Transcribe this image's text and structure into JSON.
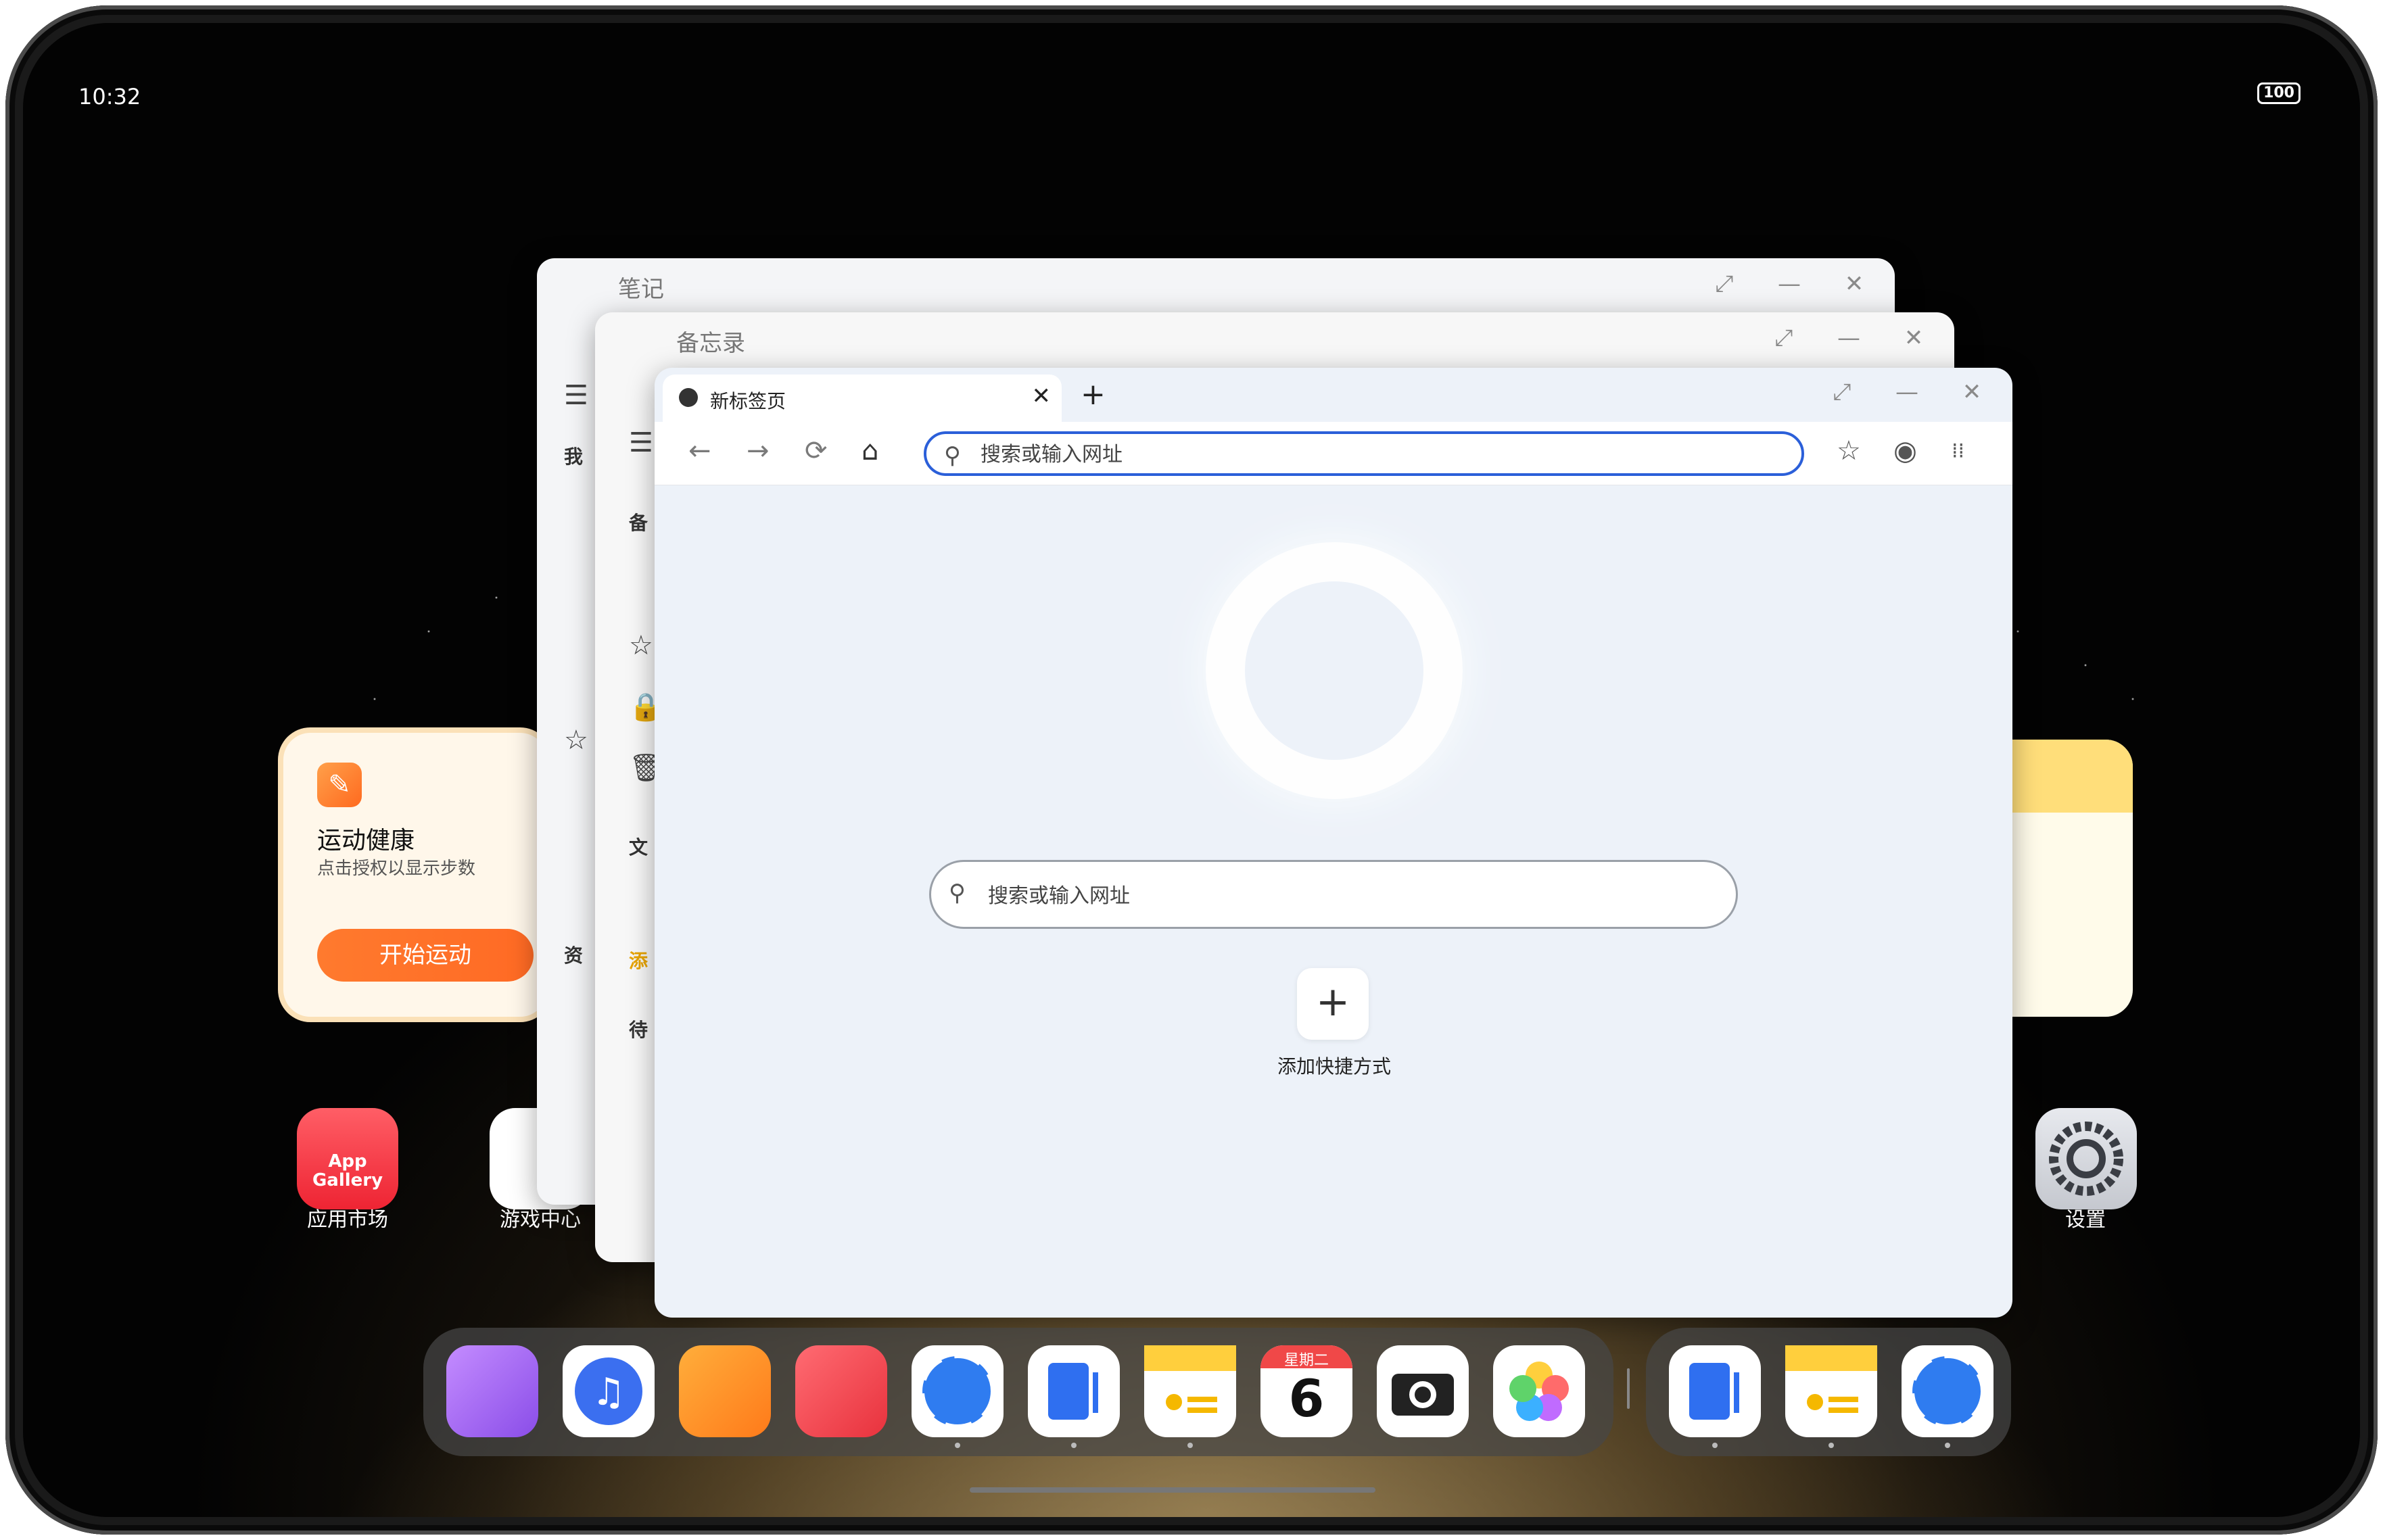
{
  "status": {
    "time": "10:32",
    "battery": "100"
  },
  "widgets": {
    "health": {
      "title": "运动健康",
      "subtitle": "点击授权以显示步数",
      "button": "开始运动"
    }
  },
  "desktop_apps": [
    {
      "label": "应用市场",
      "icon_text": "App Gallery"
    },
    {
      "label": "游戏中心"
    },
    {
      "label": "设置"
    }
  ],
  "windows": {
    "notes": {
      "title": "笔记",
      "sidebar_items": [
        "我",
        "资"
      ]
    },
    "memo": {
      "title": "备忘录",
      "sidebar_items": [
        "备",
        "文",
        "添",
        "待"
      ]
    },
    "browser": {
      "tab_title": "新标签页",
      "address_placeholder": "搜索或输入网址",
      "search_placeholder": "搜索或输入网址",
      "add_shortcut_label": "添加快捷方式"
    }
  },
  "dock": {
    "calendar": {
      "weekday": "星期二",
      "day": "6"
    }
  },
  "icons": {
    "tab_close": "✕",
    "new_tab": "+",
    "back": "←",
    "forward": "→",
    "refresh": "⟳",
    "home": "⌂",
    "search": "⚲",
    "favorites": "☆",
    "account": "◉",
    "more": "⁞⁞",
    "add": "+",
    "restore": "⤢",
    "minimize": "—",
    "close": "✕",
    "menu": "☰",
    "star": "☆",
    "lock": "🔒",
    "trash": "🗑"
  },
  "colors": {
    "accent": "#2b5fd9",
    "health_orange": "#ff6a24"
  }
}
